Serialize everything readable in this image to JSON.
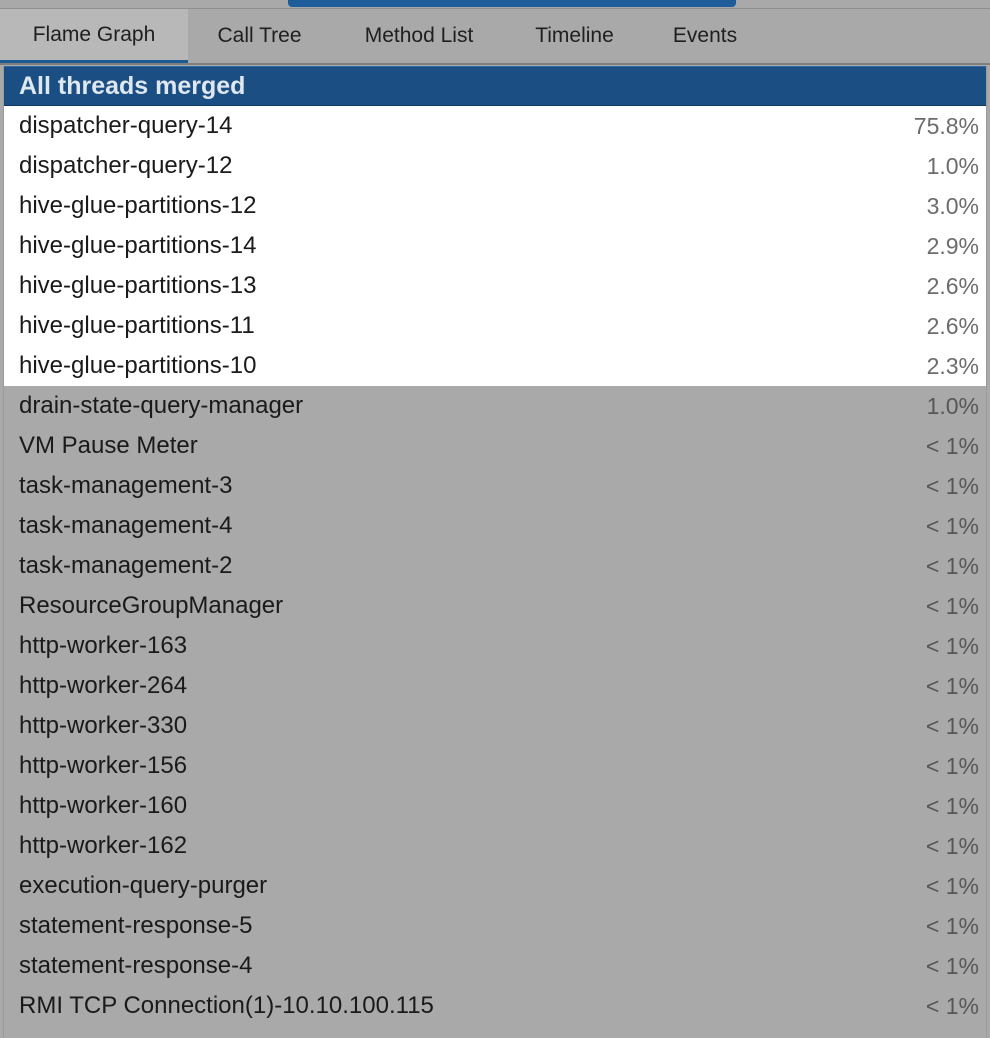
{
  "tabs": [
    {
      "label": "Flame Graph",
      "active": true
    },
    {
      "label": "Call Tree",
      "active": false
    },
    {
      "label": "Method List",
      "active": false
    },
    {
      "label": "Timeline",
      "active": false
    },
    {
      "label": "Events",
      "active": false
    }
  ],
  "group": {
    "title": "All threads merged"
  },
  "threads": [
    {
      "name": "dispatcher-query-14",
      "percent": "75.8%",
      "highlighted": true
    },
    {
      "name": "dispatcher-query-12",
      "percent": "1.0%",
      "highlighted": true
    },
    {
      "name": "hive-glue-partitions-12",
      "percent": "3.0%",
      "highlighted": true
    },
    {
      "name": "hive-glue-partitions-14",
      "percent": "2.9%",
      "highlighted": true
    },
    {
      "name": "hive-glue-partitions-13",
      "percent": "2.6%",
      "highlighted": true
    },
    {
      "name": "hive-glue-partitions-11",
      "percent": "2.6%",
      "highlighted": true
    },
    {
      "name": "hive-glue-partitions-10",
      "percent": "2.3%",
      "highlighted": true
    },
    {
      "name": "drain-state-query-manager",
      "percent": "1.0%",
      "highlighted": false
    },
    {
      "name": "VM Pause Meter",
      "percent": "< 1%",
      "highlighted": false
    },
    {
      "name": "task-management-3",
      "percent": "< 1%",
      "highlighted": false
    },
    {
      "name": "task-management-4",
      "percent": "< 1%",
      "highlighted": false
    },
    {
      "name": "task-management-2",
      "percent": "< 1%",
      "highlighted": false
    },
    {
      "name": "ResourceGroupManager",
      "percent": "< 1%",
      "highlighted": false
    },
    {
      "name": "http-worker-163",
      "percent": "< 1%",
      "highlighted": false
    },
    {
      "name": "http-worker-264",
      "percent": "< 1%",
      "highlighted": false
    },
    {
      "name": "http-worker-330",
      "percent": "< 1%",
      "highlighted": false
    },
    {
      "name": "http-worker-156",
      "percent": "< 1%",
      "highlighted": false
    },
    {
      "name": "http-worker-160",
      "percent": "< 1%",
      "highlighted": false
    },
    {
      "name": "http-worker-162",
      "percent": "< 1%",
      "highlighted": false
    },
    {
      "name": "execution-query-purger",
      "percent": "< 1%",
      "highlighted": false
    },
    {
      "name": "statement-response-5",
      "percent": "< 1%",
      "highlighted": false
    },
    {
      "name": "statement-response-4",
      "percent": "< 1%",
      "highlighted": false
    },
    {
      "name": "RMI TCP Connection(1)-10.10.100.115",
      "percent": "< 1%",
      "highlighted": false
    }
  ],
  "colors": {
    "accent": "#1b4f84",
    "highlight_row": "#ffffff",
    "background": "#a9a9a9"
  }
}
